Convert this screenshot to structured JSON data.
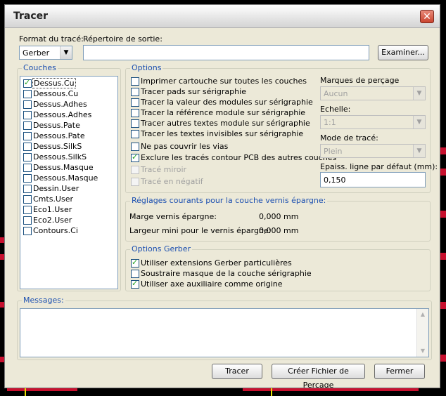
{
  "window": {
    "title": "Tracer",
    "close_glyph": "✕"
  },
  "top": {
    "format_label": "Format du tracé:",
    "format_value": "Gerber",
    "output_dir_label": "Répertoire de sortie:",
    "output_dir_value": "",
    "browse_button": "Examiner..."
  },
  "layers": {
    "title": "Couches",
    "items": [
      {
        "label": "Dessus.Cu",
        "checked": true
      },
      {
        "label": "Dessous.Cu",
        "checked": false
      },
      {
        "label": "Dessus.Adhes",
        "checked": false
      },
      {
        "label": "Dessous.Adhes",
        "checked": false
      },
      {
        "label": "Dessus.Pate",
        "checked": false
      },
      {
        "label": "Dessous.Pate",
        "checked": false
      },
      {
        "label": "Dessus.SilkS",
        "checked": false
      },
      {
        "label": "Dessous.SilkS",
        "checked": false
      },
      {
        "label": "Dessus.Masque",
        "checked": false
      },
      {
        "label": "Dessous.Masque",
        "checked": false
      },
      {
        "label": "Dessin.User",
        "checked": false
      },
      {
        "label": "Cmts.User",
        "checked": false
      },
      {
        "label": "Eco1.User",
        "checked": false
      },
      {
        "label": "Eco2.User",
        "checked": false
      },
      {
        "label": "Contours.Ci",
        "checked": false
      }
    ]
  },
  "options": {
    "title": "Options",
    "items": [
      {
        "label": "Imprimer cartouche sur toutes les couches",
        "checked": false,
        "disabled": false
      },
      {
        "label": "Tracer pads sur sérigraphie",
        "checked": false,
        "disabled": false
      },
      {
        "label": "Tracer la valeur des modules sur sérigraphie",
        "checked": false,
        "disabled": false
      },
      {
        "label": "Tracer la référence module sur sérigraphie",
        "checked": false,
        "disabled": false
      },
      {
        "label": "Tracer autres textes  module sur sérigraphie",
        "checked": false,
        "disabled": false
      },
      {
        "label": "Tracer les textes invisibles sur  sérigraphie",
        "checked": false,
        "disabled": false
      },
      {
        "label": "Ne pas couvrir les vias",
        "checked": false,
        "disabled": false
      },
      {
        "label": "Exclure les tracés contour PCB des autres couches",
        "checked": true,
        "disabled": false
      },
      {
        "label": "Tracé miroir",
        "checked": false,
        "disabled": true
      },
      {
        "label": "Tracé en négatif",
        "checked": false,
        "disabled": true
      }
    ],
    "drill_marks_label": "Marques de perçage",
    "drill_marks_value": "Aucun",
    "scale_label": "Echelle:",
    "scale_value": "1:1",
    "plot_mode_label": "Mode de tracé:",
    "plot_mode_value": "Plein",
    "line_width_label": "Epaiss. ligne par défaut (mm):",
    "line_width_value": "0,150"
  },
  "solder_mask": {
    "title": "Réglages courants pour la couche vernis épargne:",
    "margin_label": "Marge vernis épargne:",
    "margin_value": "0,000 mm",
    "min_width_label": "Largeur mini pour le vernis épargne:",
    "min_width_value": "0,000 mm"
  },
  "gerber": {
    "title": "Options Gerber",
    "items": [
      {
        "label": "Utiliser extensions Gerber particulières",
        "checked": true
      },
      {
        "label": "Soustraire masque de la couche sérigraphie",
        "checked": false
      },
      {
        "label": "Utiliser axe auxiliaire comme origine",
        "checked": true
      }
    ]
  },
  "messages": {
    "title": "Messages:"
  },
  "buttons": {
    "plot": "Tracer",
    "drill": "Créer Fichier de Perçage",
    "close": "Fermer"
  },
  "colors": {
    "accent": "#1b4fb0",
    "background_line": "#c8102e"
  }
}
